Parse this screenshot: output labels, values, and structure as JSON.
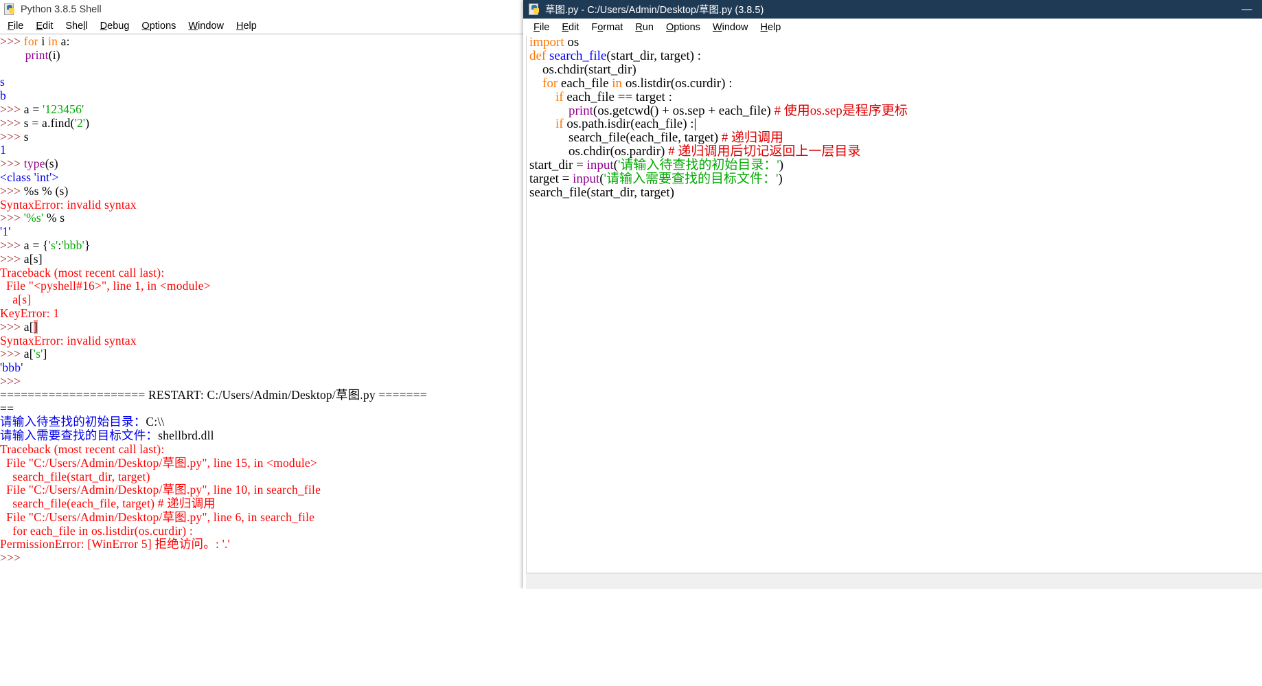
{
  "shell": {
    "title": "Python 3.8.5 Shell",
    "icon": "python-logo-icon",
    "menus": [
      "File",
      "Edit",
      "Shell",
      "Debug",
      "Options",
      "Window",
      "Help"
    ],
    "lines": [
      [
        {
          "t": ">>> ",
          "c": "c-prompt"
        },
        {
          "t": "for",
          "c": "c-kw"
        },
        {
          "t": " i ",
          "c": "c-plain"
        },
        {
          "t": "in",
          "c": "c-kw"
        },
        {
          "t": " a:",
          "c": "c-plain"
        }
      ],
      [
        {
          "t": "        ",
          "c": "c-plain"
        },
        {
          "t": "print",
          "c": "c-builtin"
        },
        {
          "t": "(i)",
          "c": "c-plain"
        }
      ],
      [
        {
          "t": "        ",
          "c": "c-plain"
        }
      ],
      [
        {
          "t": "",
          "c": "c-plain"
        }
      ],
      [
        {
          "t": "s",
          "c": "c-out"
        }
      ],
      [
        {
          "t": "b",
          "c": "c-out"
        }
      ],
      [
        {
          "t": ">>> ",
          "c": "c-prompt"
        },
        {
          "t": "a = ",
          "c": "c-plain"
        },
        {
          "t": "'123456'",
          "c": "c-str"
        }
      ],
      [
        {
          "t": ">>> ",
          "c": "c-prompt"
        },
        {
          "t": "s = a.find(",
          "c": "c-plain"
        },
        {
          "t": "'2'",
          "c": "c-str"
        },
        {
          "t": ")",
          "c": "c-plain"
        }
      ],
      [
        {
          "t": ">>> ",
          "c": "c-prompt"
        },
        {
          "t": "s",
          "c": "c-plain"
        }
      ],
      [
        {
          "t": "1",
          "c": "c-out"
        }
      ],
      [
        {
          "t": ">>> ",
          "c": "c-prompt"
        },
        {
          "t": "type",
          "c": "c-builtin"
        },
        {
          "t": "(s)",
          "c": "c-plain"
        }
      ],
      [
        {
          "t": "<class 'int'>",
          "c": "c-out"
        }
      ],
      [
        {
          "t": ">>> ",
          "c": "c-prompt"
        },
        {
          "t": "%s % (s)",
          "c": "c-plain"
        }
      ],
      [
        {
          "t": "SyntaxError: invalid syntax",
          "c": "c-err"
        }
      ],
      [
        {
          "t": ">>> ",
          "c": "c-prompt"
        },
        {
          "t": "'%s'",
          "c": "c-str"
        },
        {
          "t": " % s",
          "c": "c-plain"
        }
      ],
      [
        {
          "t": "'1'",
          "c": "c-out"
        }
      ],
      [
        {
          "t": ">>> ",
          "c": "c-prompt"
        },
        {
          "t": "a = {",
          "c": "c-plain"
        },
        {
          "t": "'s'",
          "c": "c-str"
        },
        {
          "t": ":",
          "c": "c-plain"
        },
        {
          "t": "'bbb'",
          "c": "c-str"
        },
        {
          "t": "}",
          "c": "c-plain"
        }
      ],
      [
        {
          "t": ">>> ",
          "c": "c-prompt"
        },
        {
          "t": "a[s]",
          "c": "c-plain"
        }
      ],
      [
        {
          "t": "Traceback (most recent call last):",
          "c": "c-err"
        }
      ],
      [
        {
          "t": "  File \"<pyshell#16>\", line 1, in <module>",
          "c": "c-err"
        }
      ],
      [
        {
          "t": "    a[s]",
          "c": "c-err"
        }
      ],
      [
        {
          "t": "KeyError: 1",
          "c": "c-err"
        }
      ],
      [
        {
          "t": ">>> ",
          "c": "c-prompt"
        },
        {
          "t": "a[",
          "c": "c-plain"
        },
        {
          "t": "]",
          "c": "c-plain hl"
        }
      ],
      [
        {
          "t": "SyntaxError: invalid syntax",
          "c": "c-err"
        }
      ],
      [
        {
          "t": ">>> ",
          "c": "c-prompt"
        },
        {
          "t": "a[",
          "c": "c-plain"
        },
        {
          "t": "'s'",
          "c": "c-str"
        },
        {
          "t": "]",
          "c": "c-plain"
        }
      ],
      [
        {
          "t": "'bbb'",
          "c": "c-out"
        }
      ],
      [
        {
          "t": ">>> ",
          "c": "c-prompt"
        }
      ],
      [
        {
          "t": "",
          "c": "c-plain"
        }
      ],
      [
        {
          "t": "===================== RESTART: C:/Users/Admin/Desktop/草图.py =======",
          "c": "c-plain"
        }
      ],
      [
        {
          "t": "==",
          "c": "c-plain"
        }
      ],
      [
        {
          "t": "请输入待查找的初始目录：",
          "c": "c-out"
        },
        {
          "t": "C:\\\\",
          "c": "c-plain"
        }
      ],
      [
        {
          "t": "请输入需要查找的目标文件：",
          "c": "c-out"
        },
        {
          "t": "shellbrd.dll",
          "c": "c-plain"
        }
      ],
      [
        {
          "t": "Traceback (most recent call last):",
          "c": "c-err"
        }
      ],
      [
        {
          "t": "  File \"C:/Users/Admin/Desktop/草图.py\", line 15, in <module>",
          "c": "c-err"
        }
      ],
      [
        {
          "t": "    search_file(start_dir, target)",
          "c": "c-err"
        }
      ],
      [
        {
          "t": "  File \"C:/Users/Admin/Desktop/草图.py\", line 10, in search_file",
          "c": "c-err"
        }
      ],
      [
        {
          "t": "    search_file(each_file, target) # 递归调用",
          "c": "c-err"
        }
      ],
      [
        {
          "t": "  File \"C:/Users/Admin/Desktop/草图.py\", line 6, in search_file",
          "c": "c-err"
        }
      ],
      [
        {
          "t": "    for each_file in os.listdir(os.curdir) :",
          "c": "c-err"
        }
      ],
      [
        {
          "t": "PermissionError: [WinError 5] 拒绝访问。: '.'",
          "c": "c-err"
        }
      ],
      [
        {
          "t": ">>> ",
          "c": "c-prompt"
        }
      ]
    ]
  },
  "editor": {
    "title": "草图.py - C:/Users/Admin/Desktop/草图.py (3.8.5)",
    "icon": "python-logo-icon",
    "menus": [
      "File",
      "Edit",
      "Format",
      "Run",
      "Options",
      "Window",
      "Help"
    ],
    "window_controls": {
      "minimize": "—",
      "maximize": "▢",
      "close": "✕"
    },
    "lines": [
      [
        {
          "t": "import",
          "c": "c-kw"
        },
        {
          "t": " os",
          "c": "c-plain"
        }
      ],
      [
        {
          "t": "",
          "c": "c-plain"
        }
      ],
      [
        {
          "t": "def",
          "c": "c-kw"
        },
        {
          "t": " ",
          "c": "c-plain"
        },
        {
          "t": "search_file",
          "c": "c-def"
        },
        {
          "t": "(start_dir, target) :",
          "c": "c-plain"
        }
      ],
      [
        {
          "t": "    os.chdir(start_dir)",
          "c": "c-plain"
        }
      ],
      [
        {
          "t": "",
          "c": "c-plain"
        }
      ],
      [
        {
          "t": "    ",
          "c": "c-plain"
        },
        {
          "t": "for",
          "c": "c-kw"
        },
        {
          "t": " each_file ",
          "c": "c-plain"
        },
        {
          "t": "in",
          "c": "c-kw"
        },
        {
          "t": " os.listdir(os.curdir) :",
          "c": "c-plain"
        }
      ],
      [
        {
          "t": "        ",
          "c": "c-plain"
        },
        {
          "t": "if",
          "c": "c-kw"
        },
        {
          "t": " each_file == target :",
          "c": "c-plain"
        }
      ],
      [
        {
          "t": "            ",
          "c": "c-plain"
        },
        {
          "t": "print",
          "c": "c-builtin"
        },
        {
          "t": "(os.getcwd() + os.sep + each_file) ",
          "c": "c-plain"
        },
        {
          "t": "# 使用os.sep是程序更标",
          "c": "c-cmt"
        }
      ],
      [
        {
          "t": "        ",
          "c": "c-plain"
        },
        {
          "t": "if",
          "c": "c-kw"
        },
        {
          "t": " os.path.isdir(each_file) :",
          "c": "c-plain"
        },
        {
          "t": "|",
          "c": "c-plain caret"
        }
      ],
      [
        {
          "t": "            search_file(each_file, target) ",
          "c": "c-plain"
        },
        {
          "t": "# 递归调用",
          "c": "c-cmt"
        }
      ],
      [
        {
          "t": "            os.chdir(os.pardir) ",
          "c": "c-plain"
        },
        {
          "t": "# 递归调用后切记返回上一层目录",
          "c": "c-cmt"
        }
      ],
      [
        {
          "t": "",
          "c": "c-plain"
        }
      ],
      [
        {
          "t": "start_dir = ",
          "c": "c-plain"
        },
        {
          "t": "input",
          "c": "c-builtin"
        },
        {
          "t": "(",
          "c": "c-plain"
        },
        {
          "t": "'请输入待查找的初始目录：'",
          "c": "c-str"
        },
        {
          "t": ")",
          "c": "c-plain"
        }
      ],
      [
        {
          "t": "target = ",
          "c": "c-plain"
        },
        {
          "t": "input",
          "c": "c-builtin"
        },
        {
          "t": "(",
          "c": "c-plain"
        },
        {
          "t": "'请输入需要查找的目标文件：'",
          "c": "c-str"
        },
        {
          "t": ")",
          "c": "c-plain"
        }
      ],
      [
        {
          "t": "search_file(start_dir, target)",
          "c": "c-plain"
        }
      ]
    ]
  },
  "colors": {
    "keyword": "#ff7700",
    "builtin": "#900090",
    "definition": "#0000ff",
    "string": "#00aa00",
    "stdout": "#0000ee",
    "stderr": "#ff0000",
    "comment": "#dd0000",
    "prompt": "#a52a2a",
    "editor_titlebar_bg": "#1f3a55",
    "error_highlight": "#ff9999"
  }
}
